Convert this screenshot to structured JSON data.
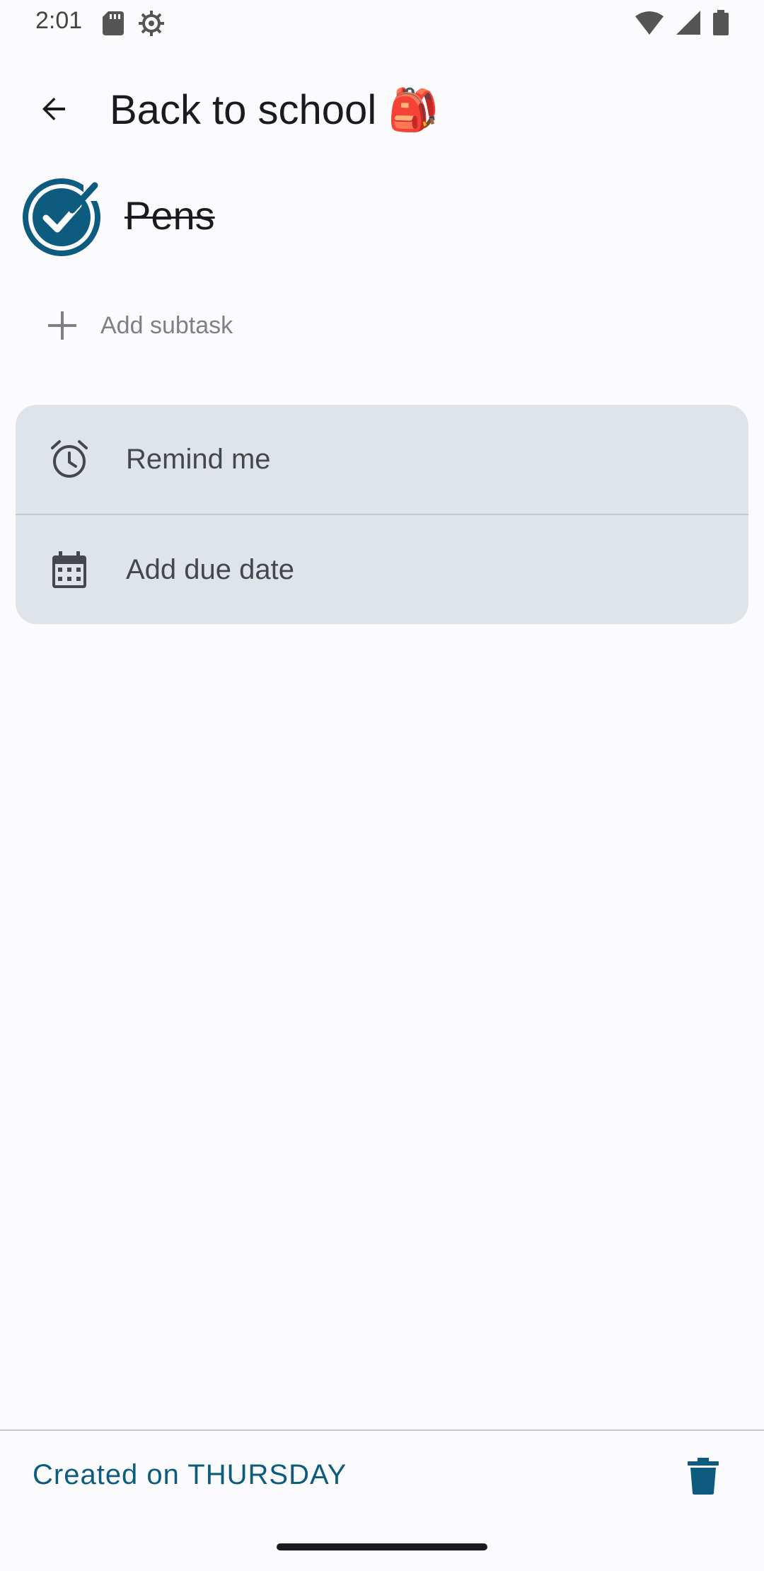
{
  "status_bar": {
    "time": "2:01",
    "left_icons": [
      "sd-card-icon",
      "settings-gear-icon"
    ],
    "right_icons": [
      "wifi-icon",
      "cell-signal-icon",
      "battery-icon"
    ]
  },
  "app_bar": {
    "title": "Back to school 🎒",
    "back_icon": "arrow-back-icon"
  },
  "task": {
    "title": "Pens",
    "completed": true,
    "check_color": "#0d5c7f"
  },
  "subtask": {
    "add_label": "Add subtask"
  },
  "options": {
    "remind_label": "Remind me",
    "due_date_label": "Add due date"
  },
  "footer": {
    "created_text": "Created on THURSDAY",
    "accent_color": "#0d5c7f"
  }
}
